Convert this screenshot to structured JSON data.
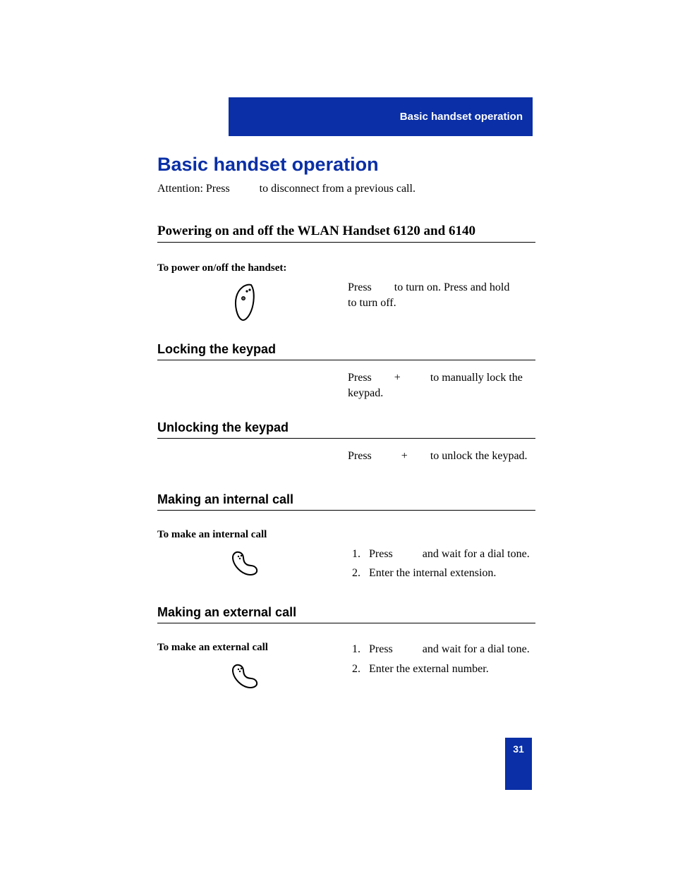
{
  "header": {
    "running_title": "Basic handset operation"
  },
  "title": "Basic handset operation",
  "attention": {
    "prefix": "Attention: Press",
    "suffix": "to disconnect from a previous call."
  },
  "sections": {
    "powering": {
      "heading": "Powering on and off the WLAN Handset 6120 and 6140",
      "sub_label": "To power on/off the handset:",
      "body_1": "Press",
      "body_2": "to turn on. Press and hold",
      "body_3": "to turn off."
    },
    "locking": {
      "heading": "Locking the keypad",
      "body_1": "Press",
      "plus": "+",
      "body_2": "to manually lock the keypad."
    },
    "unlocking": {
      "heading": "Unlocking the keypad",
      "body_1": "Press",
      "plus": "+",
      "body_2": "to unlock the keypad."
    },
    "internal": {
      "heading": "Making an internal call",
      "sub_label": "To make an internal call",
      "step1_a": "Press",
      "step1_b": "and wait for a dial tone.",
      "step2": "Enter the internal extension."
    },
    "external": {
      "heading": "Making an external call",
      "sub_label": "To make an external call",
      "step1_a": "Press",
      "step1_b": "and wait for a dial tone.",
      "step2": "Enter the external number."
    }
  },
  "page_number": "31"
}
